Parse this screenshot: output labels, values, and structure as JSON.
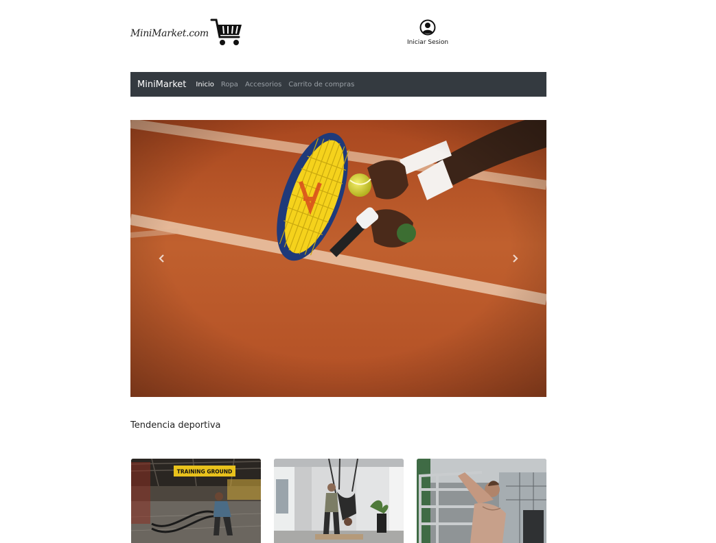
{
  "header": {
    "logo_text": "MiniMarket.com",
    "login_label": "Iniciar Sesion"
  },
  "navbar": {
    "brand": "MiniMarket",
    "links": [
      "Inicio",
      "Ropa",
      "Accesorios",
      "Carrito de compras"
    ],
    "active_index": 0
  },
  "carousel": {
    "slide_description": "tennis",
    "prev_icon": "chevron-left-icon",
    "next_icon": "chevron-right-icon"
  },
  "section": {
    "title": "Tendencia deportiva",
    "sign_text": "TRAINING GROUND"
  },
  "colors": {
    "navbar_bg": "#343a40",
    "clay": "#b8562a",
    "accent_yellow": "#f2c318"
  }
}
